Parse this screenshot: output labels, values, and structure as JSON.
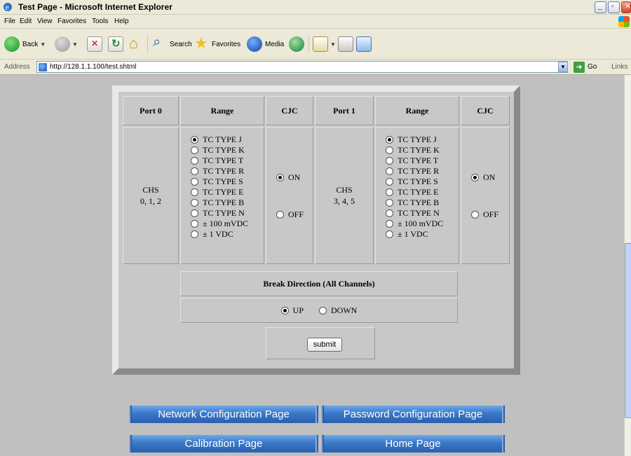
{
  "window": {
    "title": "Test Page - Microsoft Internet Explorer"
  },
  "menu": [
    "File",
    "Edit",
    "View",
    "Favorites",
    "Tools",
    "Help"
  ],
  "toolbar": {
    "back": "Back",
    "search": "Search",
    "favorites": "Favorites",
    "media": "Media"
  },
  "address": {
    "label": "Address",
    "url": "http://128.1.1.100/test.shtml",
    "go": "Go",
    "links": "Links"
  },
  "table": {
    "headers": [
      "Port 0",
      "Range",
      "CJC",
      "Port 1",
      "Range",
      "CJC"
    ],
    "port0": {
      "chs_line1": "CHS",
      "chs_line2": "0, 1, 2"
    },
    "port1": {
      "chs_line1": "CHS",
      "chs_line2": "3, 4, 5"
    },
    "range_options": [
      "TC TYPE J",
      "TC TYPE K",
      "TC TYPE T",
      "TC TYPE R",
      "TC TYPE S",
      "TC TYPE E",
      "TC TYPE B",
      "TC TYPE N",
      "± 100 mVDC",
      "± 1 VDC"
    ],
    "range0_selected": "TC TYPE J",
    "range1_selected": "TC TYPE J",
    "cjc_options": [
      "ON",
      "OFF"
    ],
    "cjc0_selected": "ON",
    "cjc1_selected": "ON"
  },
  "break_direction": {
    "title": "Break Direction (All Channels)",
    "options": [
      "UP",
      "DOWN"
    ],
    "selected": "UP"
  },
  "submit_label": "submit",
  "nav": {
    "network": "Network Configuration Page",
    "password": "Password Configuration Page",
    "calibration": "Calibration Page",
    "home": "Home Page"
  }
}
